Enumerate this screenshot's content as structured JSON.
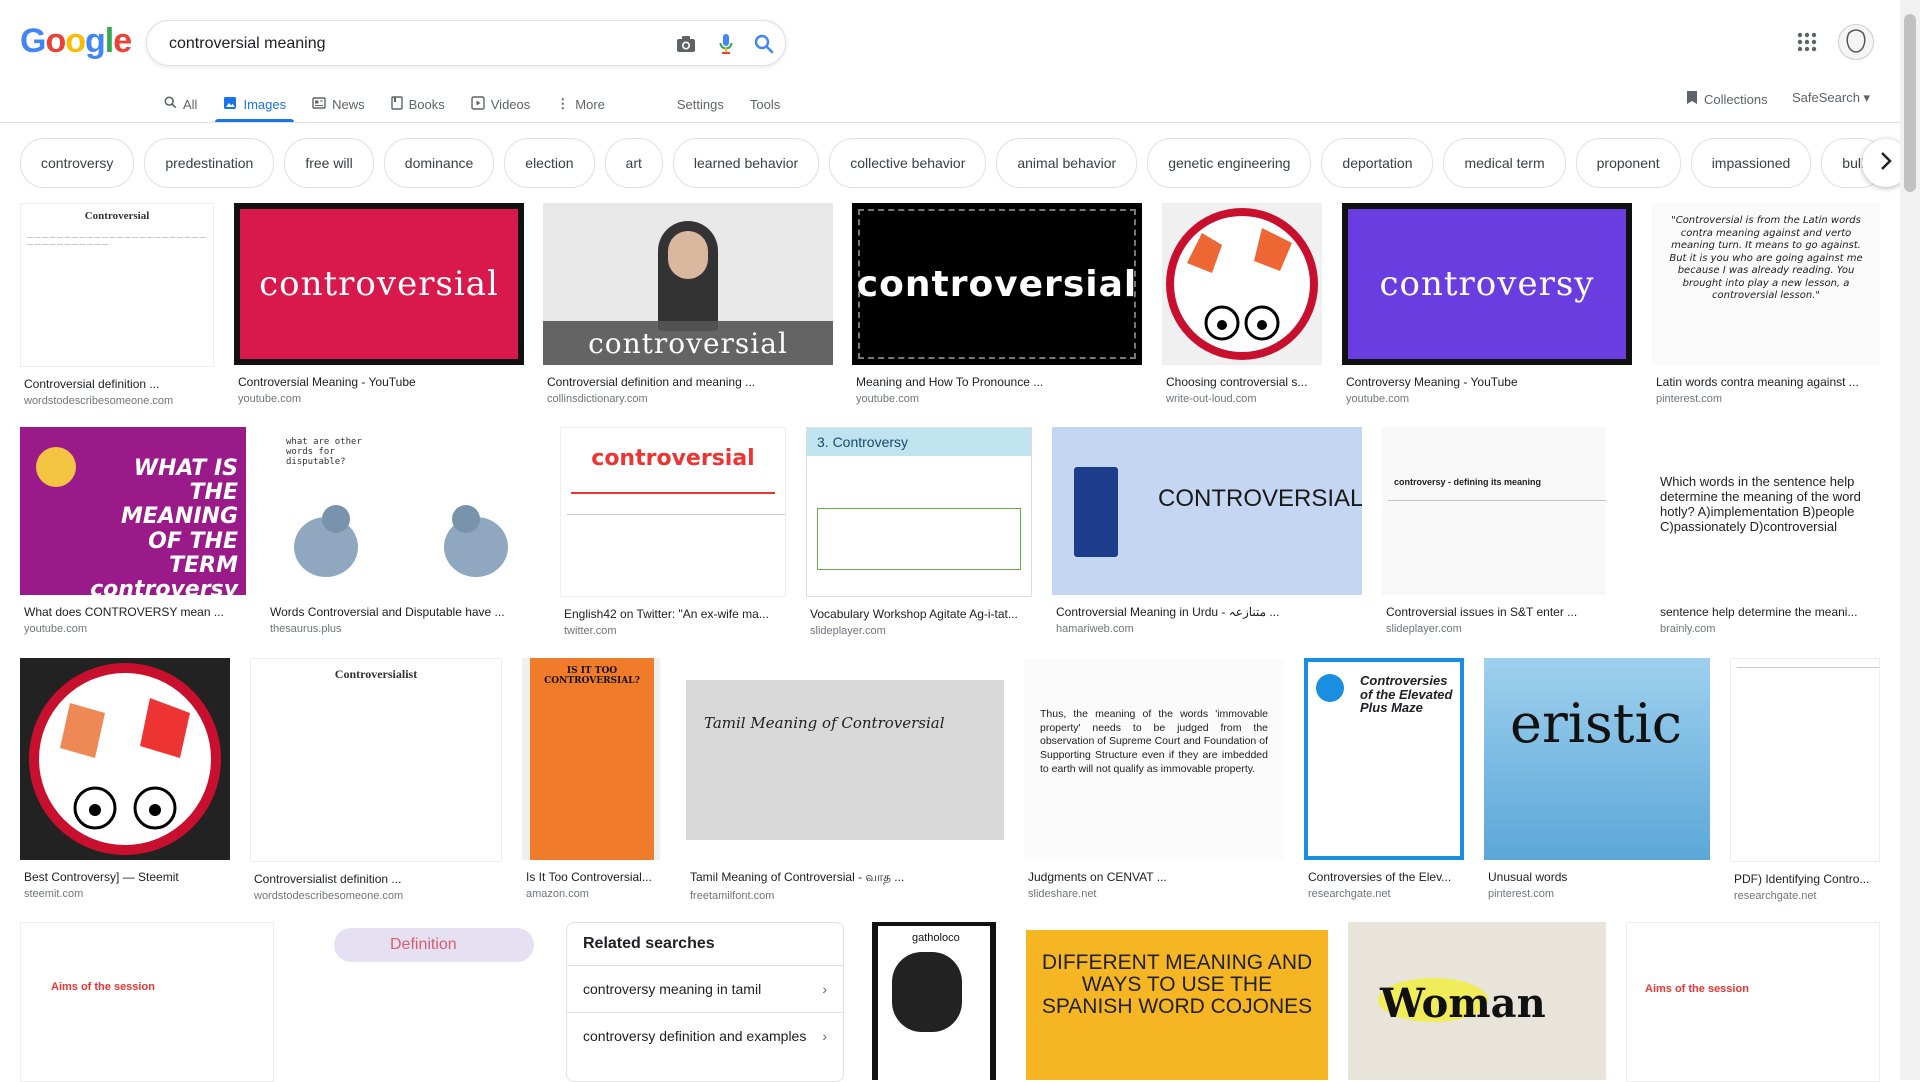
{
  "logo": [
    "G",
    "o",
    "o",
    "g",
    "l",
    "e"
  ],
  "search": {
    "query": "controversial meaning"
  },
  "tabs": [
    {
      "label": "All",
      "icon": "search-icon"
    },
    {
      "label": "Images",
      "icon": "image-icon"
    },
    {
      "label": "News",
      "icon": "news-icon"
    },
    {
      "label": "Books",
      "icon": "book-icon"
    },
    {
      "label": "Videos",
      "icon": "video-icon"
    },
    {
      "label": "More",
      "icon": "more-icon"
    },
    {
      "label": "Settings"
    },
    {
      "label": "Tools"
    }
  ],
  "collections": "Collections",
  "safesearch": "SafeSearch ▾",
  "chips": [
    "controversy",
    "predestination",
    "free will",
    "dominance",
    "election",
    "art",
    "learned behavior",
    "collective behavior",
    "animal behavior",
    "genetic engineering",
    "deportation",
    "medical term",
    "proponent",
    "impassioned",
    "bull"
  ],
  "results": [
    {
      "caption": "Controversial definition ...",
      "source": "wordstodescribesomeone.com",
      "thumb_text": "Controversial"
    },
    {
      "caption": "Controversial Meaning - YouTube",
      "source": "youtube.com",
      "thumb_text": "controversial"
    },
    {
      "caption": "Controversial definition and meaning ...",
      "source": "collinsdictionary.com",
      "thumb_text": "controversial"
    },
    {
      "caption": "Meaning and How To Pronounce ...",
      "source": "youtube.com",
      "thumb_text": "controversial"
    },
    {
      "caption": "Choosing controversial s...",
      "source": "write-out-loud.com",
      "thumb_text": ""
    },
    {
      "caption": "Controversy Meaning - YouTube",
      "source": "youtube.com",
      "thumb_text": "controversy"
    },
    {
      "caption": "Latin words contra meaning against ...",
      "source": "pinterest.com",
      "thumb_text": "\"Controversial is from the Latin words contra meaning against and verto meaning turn. It means to go against. But it is you who are going against me because I was already reading. You brought into play a new lesson, a controversial lesson.\""
    },
    {
      "caption": "What does CONTROVERSY mean ...",
      "source": "youtube.com",
      "thumb_text": "WHAT IS THE MEANING OF THE TERM controversy"
    },
    {
      "caption": "Words Controversial and Disputable have ...",
      "source": "thesaurus.plus",
      "thumb_text": "what are other words for disputable?"
    },
    {
      "caption": "English42 on Twitter: \"An ex-wife ma...",
      "source": "twitter.com",
      "thumb_text": "controversial"
    },
    {
      "caption": "Vocabulary Workshop Agitate Ag-i-tat...",
      "source": "slideplayer.com",
      "thumb_text": "3. Controversy"
    },
    {
      "caption": "Controversial Meaning in Urdu - متنازعہ ...",
      "source": "hamariweb.com",
      "thumb_text": "CONTROVERSIAL"
    },
    {
      "caption": "Controversial issues in S&T enter ...",
      "source": "slideplayer.com",
      "thumb_text": "controversy - defining its meaning"
    },
    {
      "caption": "sentence help determine the meani...",
      "source": "brainly.com",
      "thumb_text": "Which words in the sentence help determine the meaning of the word hotly? A)implementation B)people C)passionately D)controversial"
    },
    {
      "caption": "Best Controversy] — Steemit",
      "source": "steemit.com",
      "thumb_text": ""
    },
    {
      "caption": "Controversialist definition ...",
      "source": "wordstodescribesomeone.com",
      "thumb_text": "Controversialist"
    },
    {
      "caption": "Is It Too Controversial...",
      "source": "amazon.com",
      "thumb_text": "IS IT TOO CONTROVERSIAL?"
    },
    {
      "caption": "Tamil Meaning of Controversial - வாத ...",
      "source": "freetamilfont.com",
      "thumb_text": "Tamil Meaning of Controversial"
    },
    {
      "caption": "Judgments on CENVAT ...",
      "source": "slideshare.net",
      "thumb_text": "Thus, the meaning of the words 'immovable property' needs to be judged from the observation of Supreme Court and Foundation of Supporting Structure even if they are imbedded to earth will not qualify as immovable property."
    },
    {
      "caption": "Controversies of the Elev...",
      "source": "researchgate.net",
      "thumb_text": "Controversies of the Elevated Plus Maze"
    },
    {
      "caption": "Unusual words",
      "source": "pinterest.com",
      "thumb_text": "eristic"
    },
    {
      "caption": "PDF) Identifying Contro...",
      "source": "researchgate.net",
      "thumb_text": ""
    }
  ],
  "bottom_thumbs": [
    {
      "thumb_text": "Aims of the session"
    },
    {
      "thumb_text": "Definition"
    },
    {
      "thumb_text": "gatholoco"
    },
    {
      "thumb_text": "DIFFERENT MEANING AND WAYS TO USE THE SPANISH WORD COJONES"
    },
    {
      "thumb_text": "Woman"
    },
    {
      "thumb_text": "Aims of the session"
    }
  ],
  "related": {
    "title": "Related searches",
    "items": [
      "controversy meaning in tamil",
      "controversy definition and examples"
    ]
  },
  "colors": {
    "accent": "#1a73e8",
    "blue": "#4285F4",
    "red": "#EA4335",
    "yellow": "#FBBC05",
    "green": "#34A853"
  }
}
